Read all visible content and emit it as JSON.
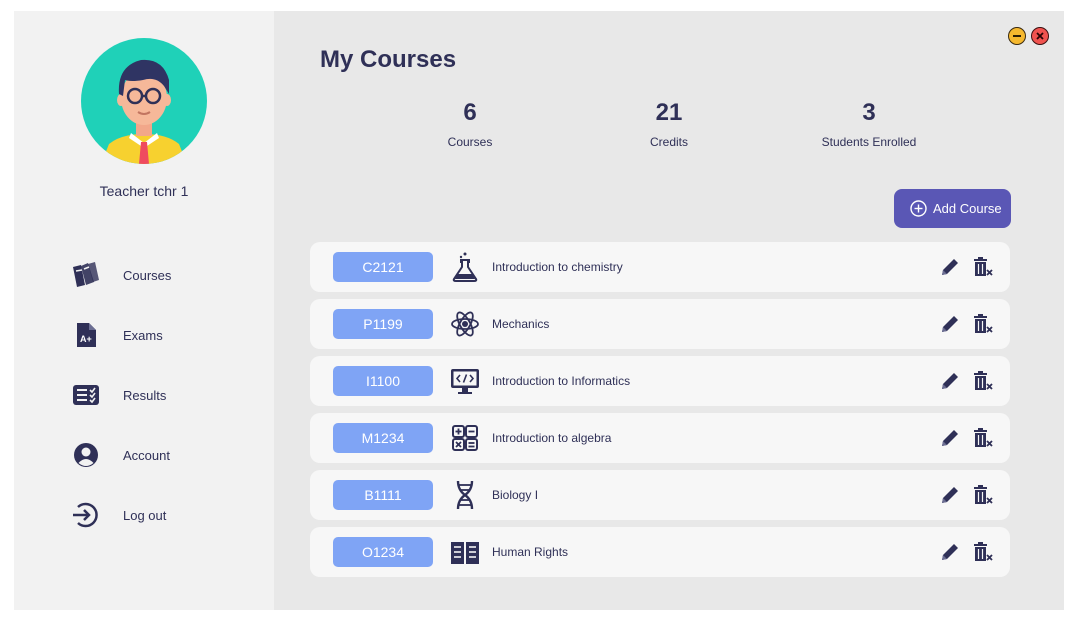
{
  "sidebar": {
    "teacher_name": "Teacher tchr 1",
    "nav": [
      {
        "label": "Courses",
        "icon": "books-icon"
      },
      {
        "label": "Exams",
        "icon": "exam-file-icon"
      },
      {
        "label": "Results",
        "icon": "results-list-icon"
      },
      {
        "label": "Account",
        "icon": "account-icon"
      },
      {
        "label": "Log out",
        "icon": "logout-icon"
      }
    ]
  },
  "main": {
    "title": "My Courses",
    "stats": [
      {
        "value": "6",
        "label": "Courses"
      },
      {
        "value": "21",
        "label": "Credits"
      },
      {
        "value": "3",
        "label": "Students Enrolled"
      }
    ],
    "add_button_label": "Add Course",
    "courses": [
      {
        "code": "C2121",
        "name": "Introduction to chemistry",
        "icon": "flask-icon"
      },
      {
        "code": "P1199",
        "name": "Mechanics",
        "icon": "atom-icon"
      },
      {
        "code": "I1100",
        "name": "Introduction to Informatics",
        "icon": "code-monitor-icon"
      },
      {
        "code": "M1234",
        "name": "Introduction to algebra",
        "icon": "calculator-icon"
      },
      {
        "code": "B1111",
        "name": "Biology I",
        "icon": "dna-icon"
      },
      {
        "code": "O1234",
        "name": "Human Rights",
        "icon": "book-icon"
      }
    ]
  },
  "colors": {
    "accent": "#5a57b5",
    "badge": "#7fa4f5",
    "text": "#2f3057",
    "avatar_bg": "#1fd1b8",
    "minimize": "#f5b82e",
    "close": "#f0534f"
  }
}
